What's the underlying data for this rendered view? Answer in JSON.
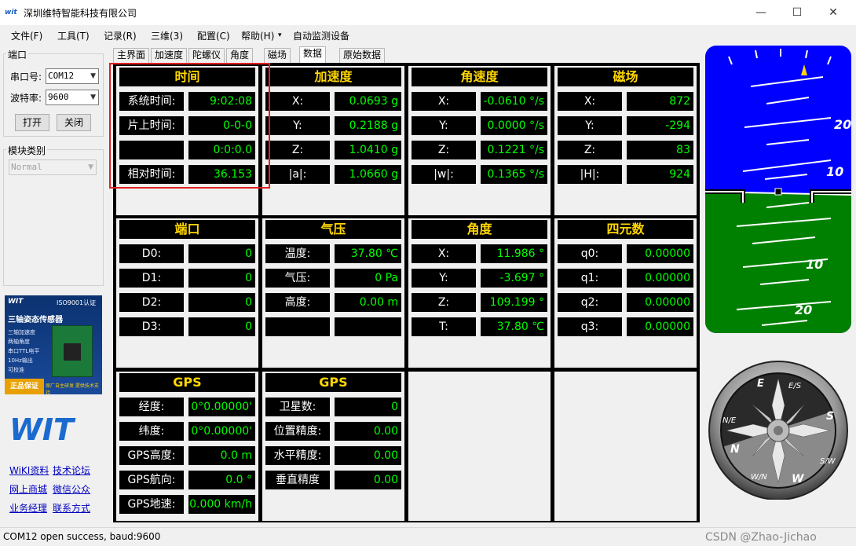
{
  "window": {
    "title": "深圳维特智能科技有限公司",
    "icon_text": "wit",
    "minimize": "—",
    "maximize": "☐",
    "close": "✕"
  },
  "menu": [
    "文件(F)",
    "工具(T)",
    "记录(R)",
    "三维(3)",
    "配置(C)",
    "帮助(H)",
    "▾",
    "自动监测设备"
  ],
  "serial": {
    "group_title": "端口",
    "port_label": "串口号:",
    "port_value": "COM12",
    "baud_label": "波特率:",
    "baud_value": "9600",
    "open_button": "打开",
    "close_button": "关闭"
  },
  "module": {
    "group_title": "模块类别",
    "value": "Normal"
  },
  "ad": {
    "logo": "WIT",
    "iso": "ISO9001认证",
    "title": "三轴姿态传感器",
    "features": [
      "三轴加速度",
      "两轴角度",
      "串口TTL电平",
      "10Hz输出",
      "可校准"
    ],
    "quality": "正品保证",
    "slogan": "原厂自主研发 提供技术支持"
  },
  "logo_text": "WIT",
  "links": [
    "WiKI资料",
    "技术论坛",
    "网上商城",
    "微信公众",
    "业务经理",
    "联系方式"
  ],
  "tabs": [
    "主界面",
    "加速度",
    "陀螺仪",
    "角度",
    "磁场",
    "数据",
    "原始数据"
  ],
  "active_tab": "数据",
  "panels": {
    "time": {
      "title": "时间",
      "rows": [
        {
          "label": "系统时间:",
          "value": "9:02:08"
        },
        {
          "label": "片上时间:",
          "value": "0-0-0"
        },
        {
          "label": "",
          "value": "0:0:0.0"
        },
        {
          "label": "相对时间:",
          "value": "36.153"
        }
      ]
    },
    "accel": {
      "title": "加速度",
      "rows": [
        {
          "label": "X:",
          "value": "0.0693 g"
        },
        {
          "label": "Y:",
          "value": "0.2188 g"
        },
        {
          "label": "Z:",
          "value": "1.0410 g"
        },
        {
          "label": "|a|:",
          "value": "1.0660 g"
        }
      ]
    },
    "gyro": {
      "title": "角速度",
      "rows": [
        {
          "label": "X:",
          "value": "-0.0610 °/s"
        },
        {
          "label": "Y:",
          "value": "0.0000 °/s"
        },
        {
          "label": "Z:",
          "value": "0.1221 °/s"
        },
        {
          "label": "|w|:",
          "value": "0.1365 °/s"
        }
      ]
    },
    "mag": {
      "title": "磁场",
      "rows": [
        {
          "label": "X:",
          "value": "872"
        },
        {
          "label": "Y:",
          "value": "-294"
        },
        {
          "label": "Z:",
          "value": "83"
        },
        {
          "label": "|H|:",
          "value": "924"
        }
      ]
    },
    "port": {
      "title": "端口",
      "rows": [
        {
          "label": "D0:",
          "value": "0"
        },
        {
          "label": "D1:",
          "value": "0"
        },
        {
          "label": "D2:",
          "value": "0"
        },
        {
          "label": "D3:",
          "value": "0"
        }
      ]
    },
    "pressure": {
      "title": "气压",
      "rows": [
        {
          "label": "温度:",
          "value": "37.80 ℃"
        },
        {
          "label": "气压:",
          "value": "0 Pa"
        },
        {
          "label": "高度:",
          "value": "0.00 m"
        },
        {
          "label": "",
          "value": ""
        }
      ]
    },
    "angle": {
      "title": "角度",
      "rows": [
        {
          "label": "X:",
          "value": "11.986 °"
        },
        {
          "label": "Y:",
          "value": "-3.697 °"
        },
        {
          "label": "Z:",
          "value": "109.199 °"
        },
        {
          "label": "T:",
          "value": "37.80 ℃"
        }
      ]
    },
    "quat": {
      "title": "四元数",
      "rows": [
        {
          "label": "q0:",
          "value": "0.00000"
        },
        {
          "label": "q1:",
          "value": "0.00000"
        },
        {
          "label": "q2:",
          "value": "0.00000"
        },
        {
          "label": "q3:",
          "value": "0.00000"
        }
      ]
    },
    "gps1": {
      "title": "GPS",
      "rows": [
        {
          "label": "经度:",
          "value": "0°0.00000'"
        },
        {
          "label": "纬度:",
          "value": "0°0.00000'"
        },
        {
          "label": "GPS高度:",
          "value": "0.0 m"
        },
        {
          "label": "GPS航向:",
          "value": "0.0 °"
        },
        {
          "label": "GPS地速:",
          "value": "0.000 km/h"
        }
      ]
    },
    "gps2": {
      "title": "GPS",
      "rows": [
        {
          "label": "卫星数:",
          "value": "0"
        },
        {
          "label": "位置精度:",
          "value": "0.00"
        },
        {
          "label": "水平精度:",
          "value": "0.00"
        },
        {
          "label": "垂直精度",
          "value": "0.00"
        }
      ]
    }
  },
  "attitude": {
    "pitch_labels": [
      "20",
      "10",
      "10",
      "20"
    ],
    "sky_color": "#0000ff",
    "ground_color": "#008000"
  },
  "compass": {
    "cardinals": [
      "N",
      "E",
      "S",
      "W"
    ],
    "minor_labels": [
      "N/E",
      "E/S",
      "S/W",
      "W/N"
    ]
  },
  "status": {
    "text": "COM12 open success, baud:9600",
    "watermark": "CSDN @Zhao-Jichao"
  }
}
